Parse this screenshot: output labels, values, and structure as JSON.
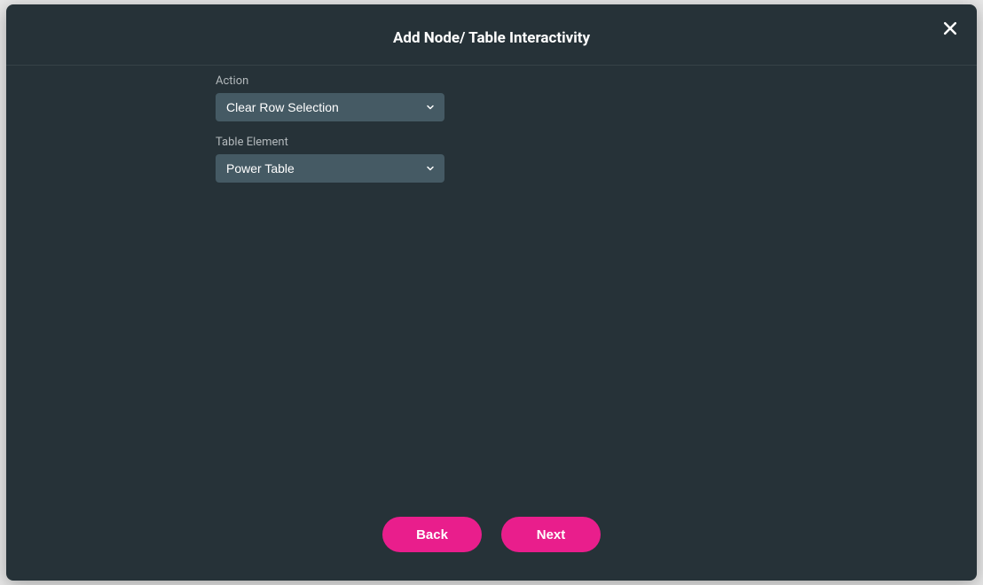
{
  "modal": {
    "title": "Add Node/ Table Interactivity"
  },
  "form": {
    "action": {
      "label": "Action",
      "value": "Clear Row Selection"
    },
    "tableElement": {
      "label": "Table Element",
      "value": "Power Table"
    }
  },
  "buttons": {
    "back": "Back",
    "next": "Next"
  },
  "colors": {
    "accent": "#e91e8c",
    "background": "#263238",
    "selectBg": "#455a64"
  }
}
